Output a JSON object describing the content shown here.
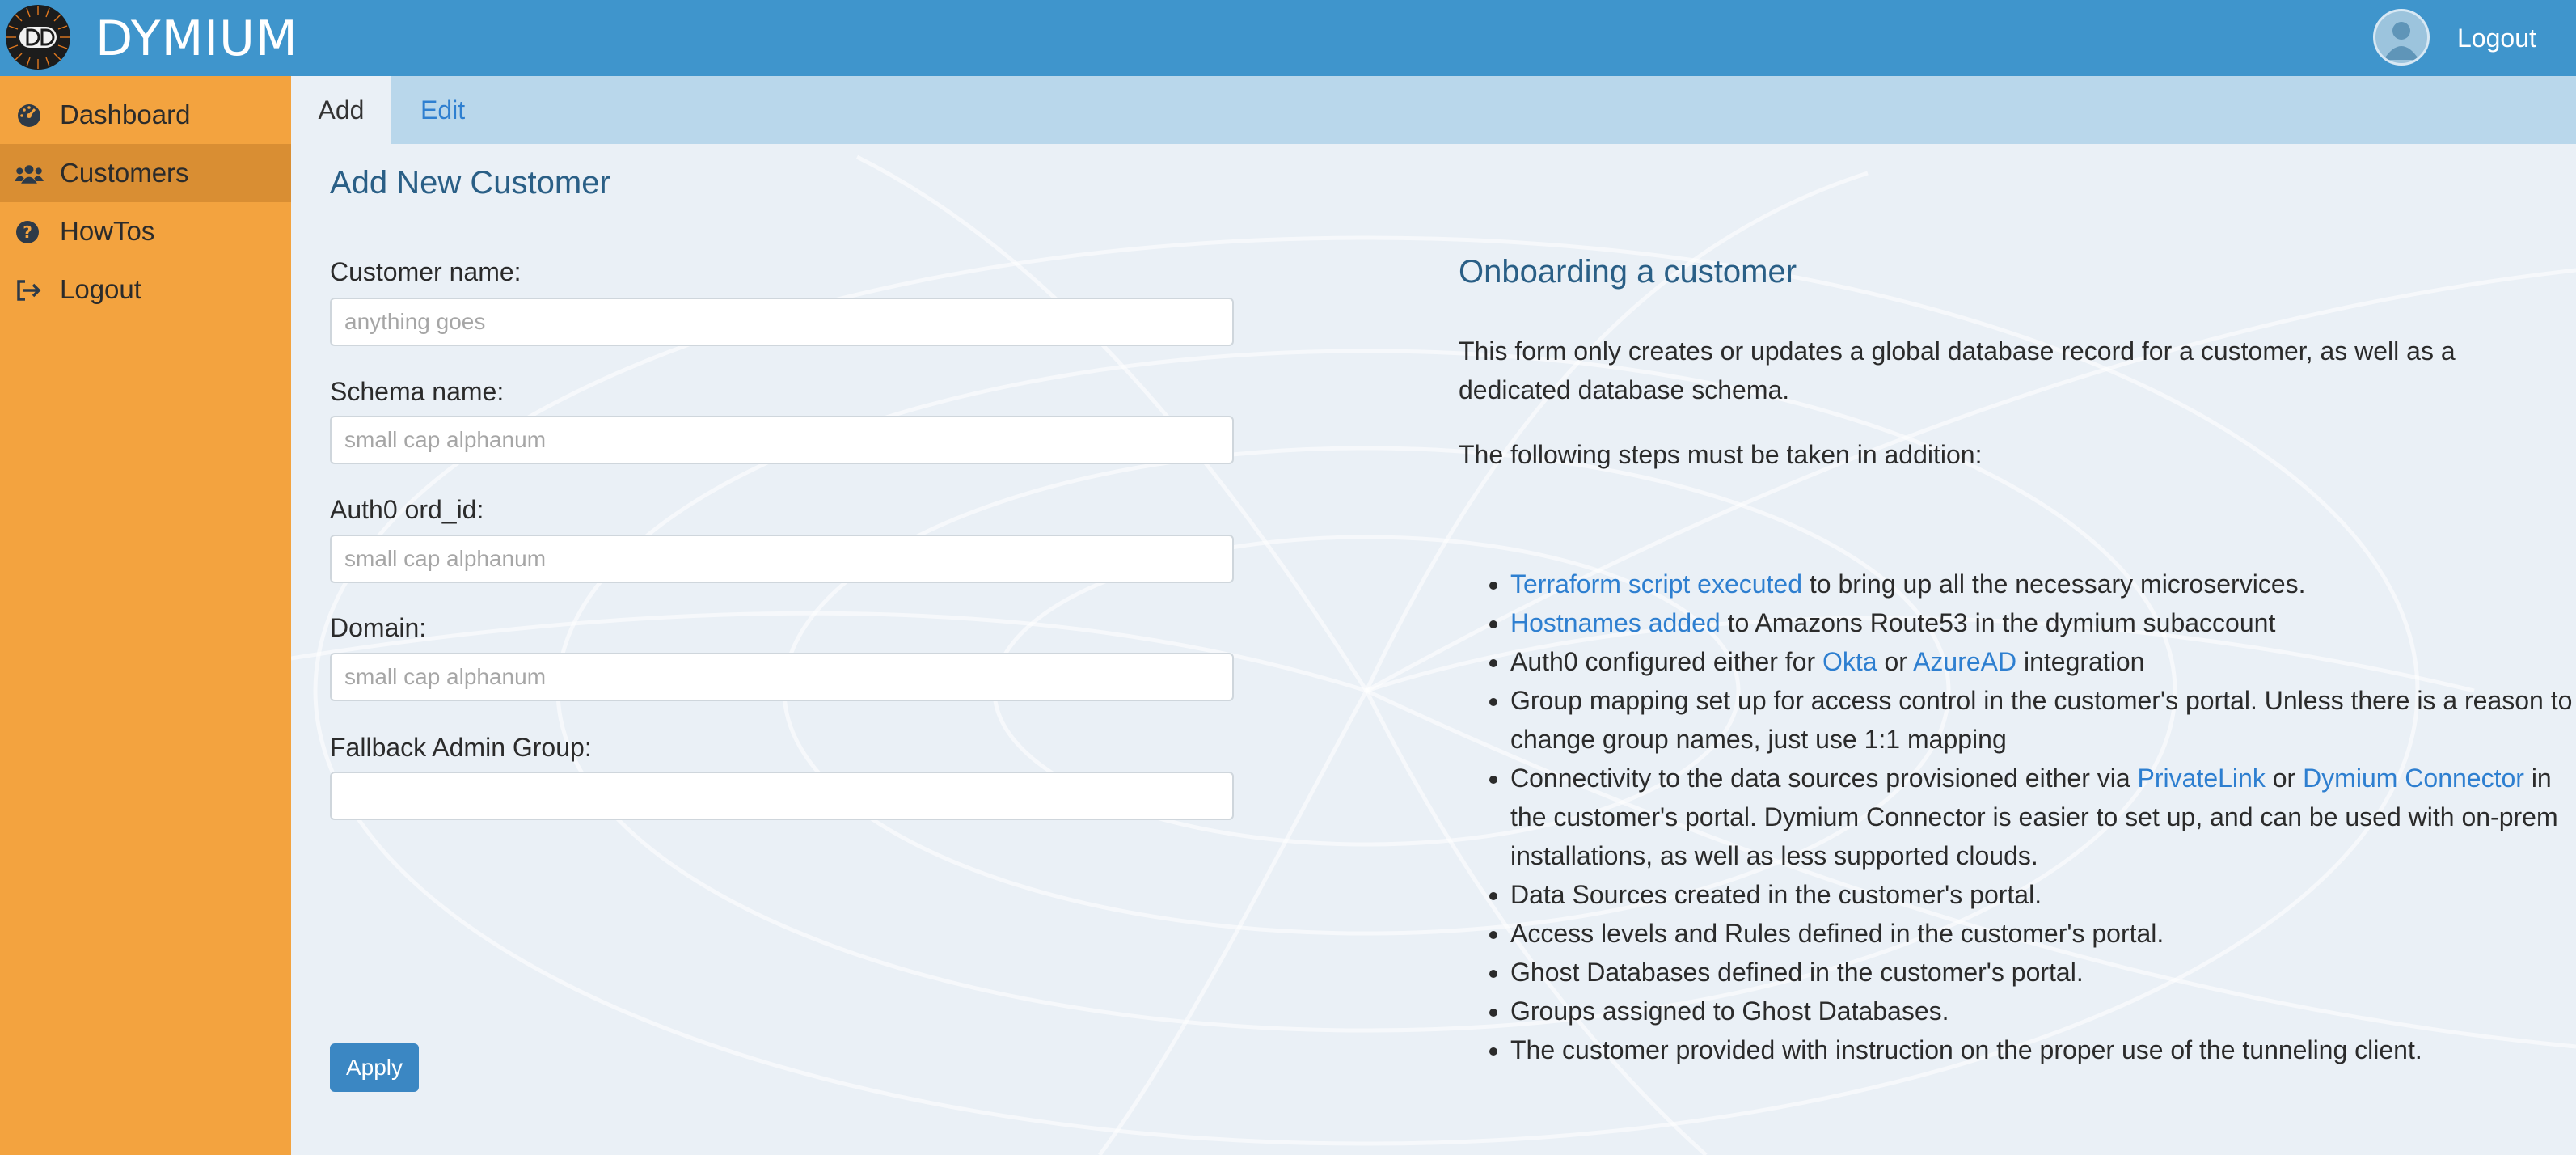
{
  "header": {
    "brand": "DYMIUM",
    "logout_label": "Logout"
  },
  "sidebar": {
    "items": [
      {
        "label": "Dashboard",
        "icon": "gauge-icon"
      },
      {
        "label": "Customers",
        "icon": "users-icon",
        "active": true
      },
      {
        "label": "HowTos",
        "icon": "question-circle-icon"
      },
      {
        "label": "Logout",
        "icon": "sign-out-icon"
      }
    ]
  },
  "tabs": [
    {
      "label": "Add",
      "active": true
    },
    {
      "label": "Edit",
      "active": false
    }
  ],
  "form": {
    "title": "Add New Customer",
    "fields": [
      {
        "label": "Customer name:",
        "placeholder": "anything goes",
        "value": ""
      },
      {
        "label": "Schema name:",
        "placeholder": "small cap alphanum",
        "value": ""
      },
      {
        "label": "Auth0 ord_id:",
        "placeholder": "small cap alphanum",
        "value": ""
      },
      {
        "label": "Domain:",
        "placeholder": "small cap alphanum",
        "value": ""
      },
      {
        "label": "Fallback Admin Group:",
        "placeholder": "",
        "value": ""
      }
    ],
    "apply_label": "Apply"
  },
  "info": {
    "title": "Onboarding a customer",
    "paragraph": "This form only creates or updates a global database record for a customer, as well as a dedicated database schema.",
    "steps_intro": "The following steps must be taken in addition:",
    "steps": {
      "s1": {
        "link": "Terraform script executed",
        "text": " to bring up all the necessary microservices."
      },
      "s2": {
        "link": "Hostnames added",
        "text": " to Amazons Route53 in the dymium subaccount"
      },
      "s3": {
        "pre": "Auth0 configured either for ",
        "link1": "Okta",
        "mid": " or ",
        "link2": "AzureAD",
        "post": " integration"
      },
      "s4": "Group mapping set up for access control in the customer's portal. Unless there is a reason to change group names, just use 1:1 mapping",
      "s5": {
        "pre": "Connectivity to the data sources provisioned either via ",
        "link1": "PrivateLink",
        "mid": " or ",
        "link2": "Dymium Connector",
        "post": " in the customer's portal. Dymium Connector is easier to set up, and can be used with on-prem installations, as well as less supported clouds."
      },
      "s6": "Data Sources created in the customer's portal.",
      "s7": "Access levels and Rules defined in the customer's portal.",
      "s8": "Ghost Databases defined in the customer's portal.",
      "s9": "Groups assigned to Ghost Databases.",
      "s10": "The customer provided with instruction on the proper use of the tunneling client."
    }
  },
  "colors": {
    "header": "#3f95cc",
    "sidebar": "#f3a33f",
    "sidebar_active": "#d98e33",
    "tabbar": "#b9d7eb",
    "link": "#2e7fd0",
    "title": "#2a5f86",
    "button": "#3b87c3"
  }
}
